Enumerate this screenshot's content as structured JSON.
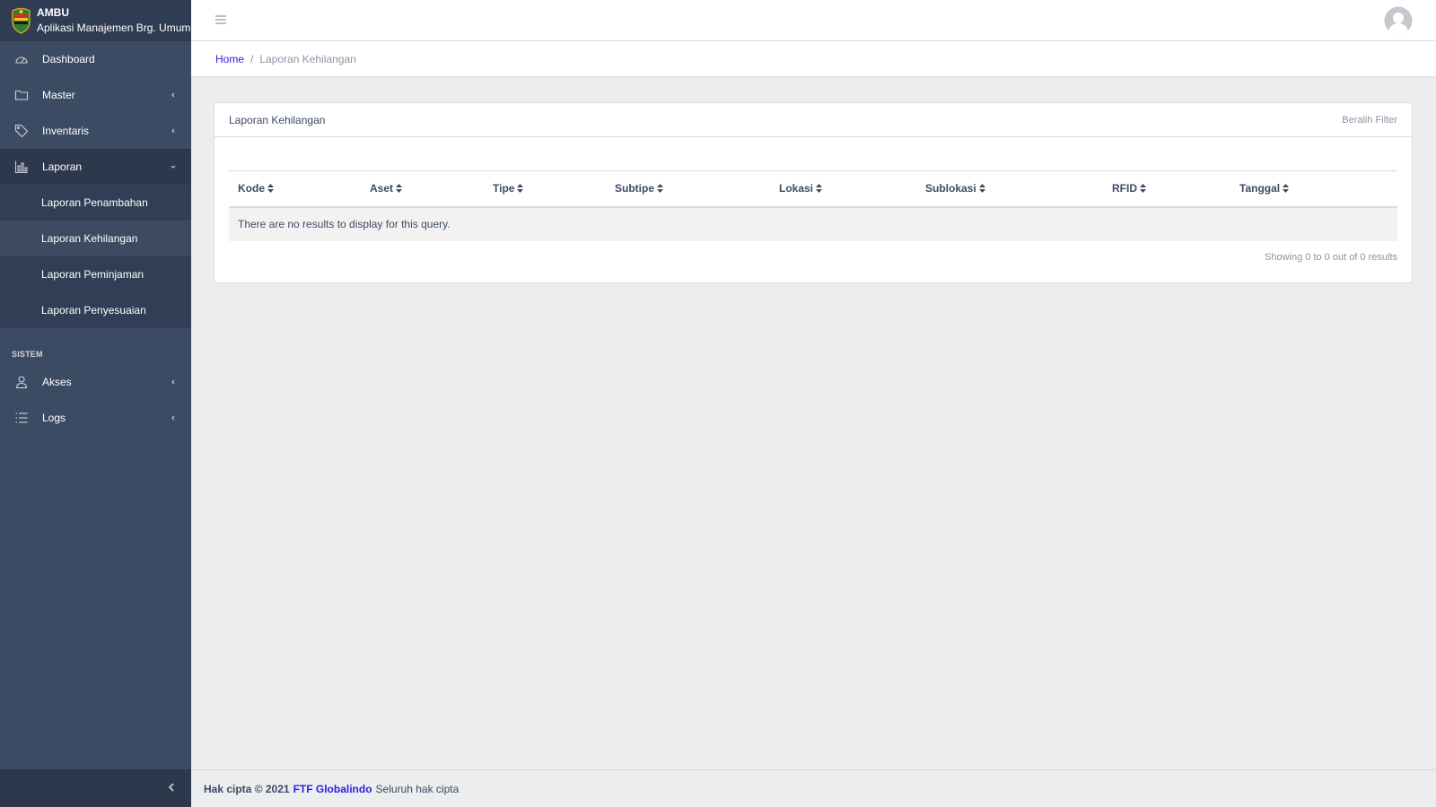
{
  "brand": {
    "title": "AMBU",
    "subtitle": "Aplikasi Manajemen Brg. Umum"
  },
  "sidebar": {
    "items": [
      {
        "label": "Dashboard",
        "icon": "speedometer-icon"
      },
      {
        "label": "Master",
        "icon": "folder-icon"
      },
      {
        "label": "Inventaris",
        "icon": "tag-icon"
      },
      {
        "label": "Laporan",
        "icon": "chart-icon"
      }
    ],
    "laporan_sub": [
      {
        "label": "Laporan Penambahan"
      },
      {
        "label": "Laporan Kehilangan"
      },
      {
        "label": "Laporan Peminjaman"
      },
      {
        "label": "Laporan Penyesuaian"
      }
    ],
    "section_title": "SISTEM",
    "system_items": [
      {
        "label": "Akses",
        "icon": "user-icon"
      },
      {
        "label": "Logs",
        "icon": "list-icon"
      }
    ]
  },
  "breadcrumb": {
    "home": "Home",
    "separator": "/",
    "current": "Laporan Kehilangan"
  },
  "card": {
    "title": "Laporan Kehilangan",
    "filter_label": "Beralih Filter",
    "columns": [
      "Kode",
      "Aset",
      "Tipe",
      "Subtipe",
      "Lokasi",
      "Sublokasi",
      "RFID",
      "Tanggal"
    ],
    "empty_message": "There are no results to display for this query.",
    "results_text": "Showing 0 to 0 out of 0 results"
  },
  "footer": {
    "copyright": "Hak cipta © 2021",
    "company": "FTF Globalindo",
    "rights": "Seluruh hak cipta"
  },
  "colors": {
    "sidebar": "#3c4b64",
    "brand_bg": "#303c54",
    "accent": "#321fdb",
    "body_bg": "#ebedef"
  }
}
